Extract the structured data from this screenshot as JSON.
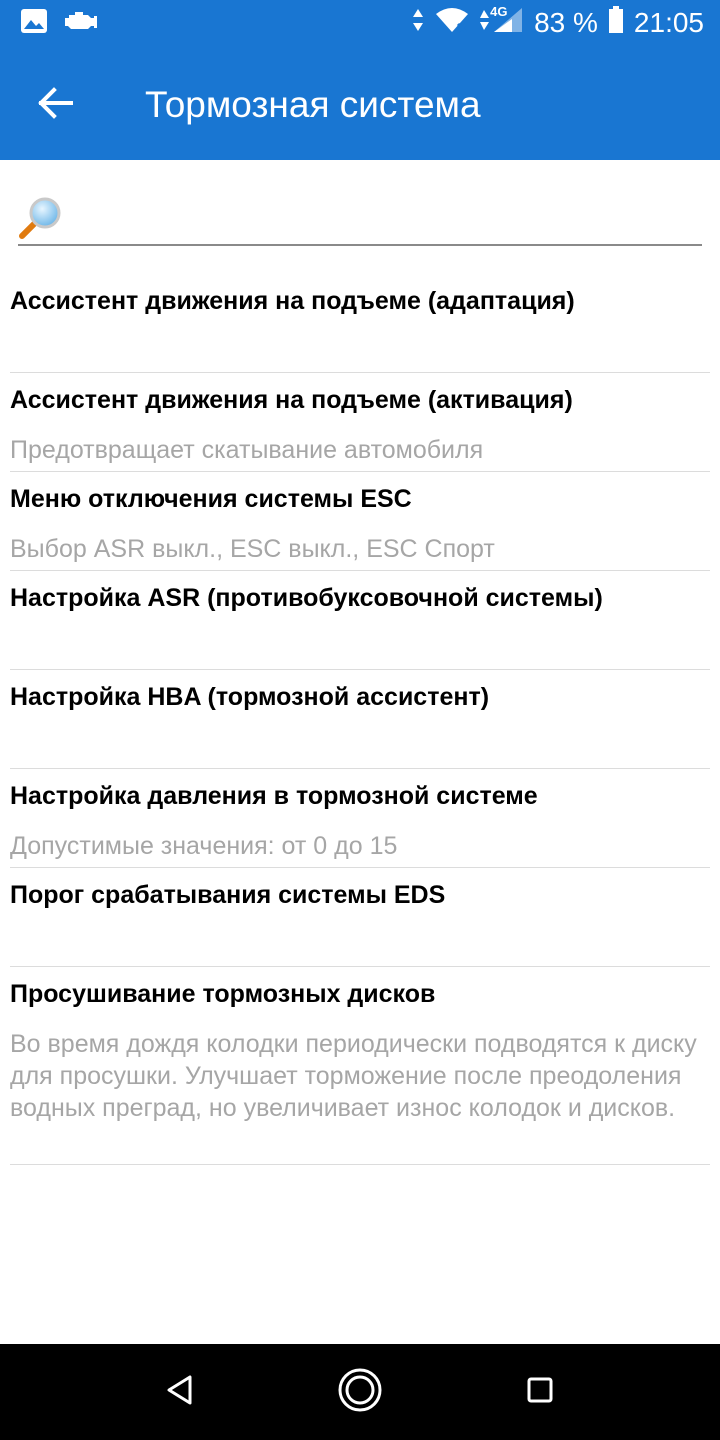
{
  "status_bar": {
    "battery": "83 %",
    "time": "21:05",
    "network": "4G"
  },
  "toolbar": {
    "title": "Тормозная система"
  },
  "search": {
    "value": "",
    "placeholder": ""
  },
  "items": [
    {
      "title": "Ассистент движения на подъеме (адаптация)",
      "subtitle": ""
    },
    {
      "title": "Ассистент движения на подъеме (активация)",
      "subtitle": "Предотвращает скатывание автомобиля"
    },
    {
      "title": "Меню отключения системы ESC",
      "subtitle": "Выбор ASR выкл., ESC выкл., ESC Спорт"
    },
    {
      "title": "Настройка ASR (противобуксовочной системы)",
      "subtitle": ""
    },
    {
      "title": "Настройка HBA (тормозной ассистент)",
      "subtitle": ""
    },
    {
      "title": "Настройка давления в тормозной системе",
      "subtitle": "Допустимые значения: от 0 до 15"
    },
    {
      "title": "Порог срабатывания системы EDS",
      "subtitle": ""
    },
    {
      "title": "Просушивание тормозных дисков",
      "subtitle": "Во время дождя колодки периодически подводятся к диску для просушки. Улучшает торможение после преодоления водных преград, но увеличивает износ колодок и дисков."
    }
  ],
  "colors": {
    "app_bar": "#1976d2",
    "title_text": "#000000",
    "subtitle_text": "#a6a6a6",
    "divider": "#dcdcdc"
  },
  "icons": {
    "status_left": [
      "image-icon",
      "check-engine-icon"
    ],
    "status_right": [
      "data-arrows-icon",
      "wifi-icon",
      "signal-icon",
      "battery-icon"
    ],
    "toolbar": "back-arrow-icon",
    "search": "magnifier-icon",
    "nav": [
      "back-triangle-icon",
      "home-circle-icon",
      "recents-square-icon"
    ]
  }
}
